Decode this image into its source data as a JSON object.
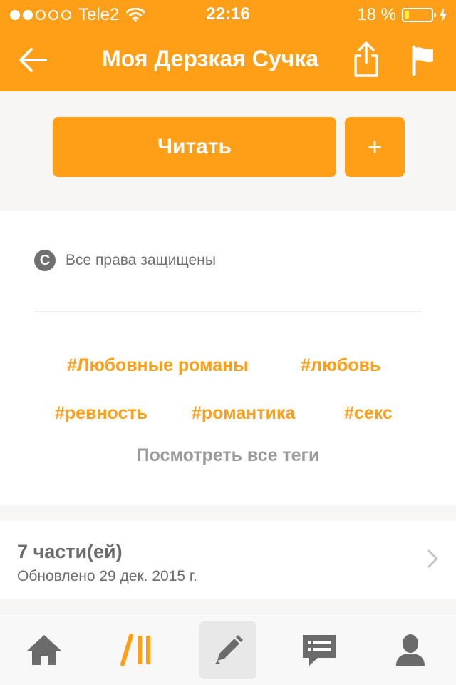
{
  "status_bar": {
    "carrier": "Tele2",
    "time": "22:16",
    "battery_percent": "18 %",
    "battery_level": 0.18,
    "signal_dots_filled": 2,
    "signal_dots_total": 5
  },
  "nav": {
    "title": "Моя Дерзкая Сучка"
  },
  "actions": {
    "read_label": "Читать",
    "add_label": "+"
  },
  "info": {
    "copyright_symbol": "C",
    "copyright_text": "Все права защищены",
    "tags": [
      "#Любовные романы",
      "#любовь",
      "#ревность",
      "#романтика",
      "#секс"
    ],
    "view_all_tags": "Посмотреть все теги"
  },
  "parts": {
    "count_label": "7 части(ей)",
    "updated_label": "Обновлено 29 дек. 2015 г."
  },
  "tabbar": {
    "tabs": [
      {
        "name": "home",
        "icon": "home-icon"
      },
      {
        "name": "library",
        "icon": "library-icon"
      },
      {
        "name": "write",
        "icon": "pencil-icon",
        "active": true
      },
      {
        "name": "messages",
        "icon": "chat-icon"
      },
      {
        "name": "profile",
        "icon": "profile-icon"
      }
    ]
  },
  "colors": {
    "accent": "#ff9f17",
    "text_gray": "#6b6b6b",
    "background": "#f8f6f4"
  }
}
